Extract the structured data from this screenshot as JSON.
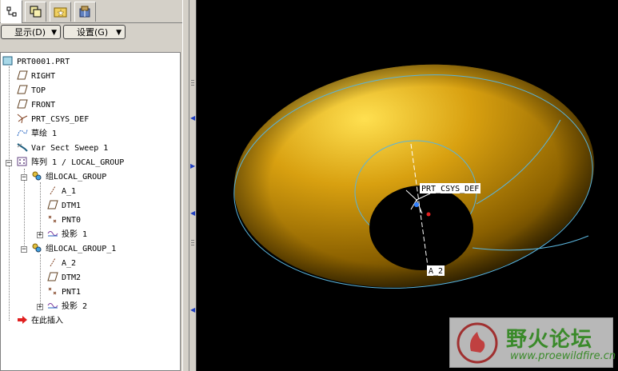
{
  "toolbar": {
    "display_label": "显示(D)",
    "settings_label": "设置(G)"
  },
  "tabs": [
    "model-tree-tab",
    "layers-tab",
    "favorites-tab",
    "tools-tab"
  ],
  "tree": {
    "root": "PRT0001.PRT",
    "items": [
      {
        "label": "RIGHT"
      },
      {
        "label": "TOP"
      },
      {
        "label": "FRONT"
      },
      {
        "label": "PRT_CSYS_DEF"
      },
      {
        "label": "草绘 1"
      },
      {
        "label": "Var Sect Sweep 1"
      },
      {
        "label": "阵列 1 / LOCAL_GROUP"
      },
      {
        "label": "组LOCAL_GROUP"
      },
      {
        "label": "A_1"
      },
      {
        "label": "DTM1"
      },
      {
        "label": "PNT0"
      },
      {
        "label": "投影 1"
      },
      {
        "label": "组LOCAL_GROUP_1"
      },
      {
        "label": "A_2"
      },
      {
        "label": "DTM2"
      },
      {
        "label": "PNT1"
      },
      {
        "label": "投影 2"
      },
      {
        "label": "在此插入"
      }
    ]
  },
  "viewport": {
    "csys_label": "PRT_CSYS_DEF",
    "axis_label": "A_2",
    "background": "#000000",
    "surface_color": "#c8960a",
    "curve_color": "#5ab4dc"
  },
  "watermark": {
    "title": "野火论坛",
    "url": "www.proewildfire.cn"
  }
}
